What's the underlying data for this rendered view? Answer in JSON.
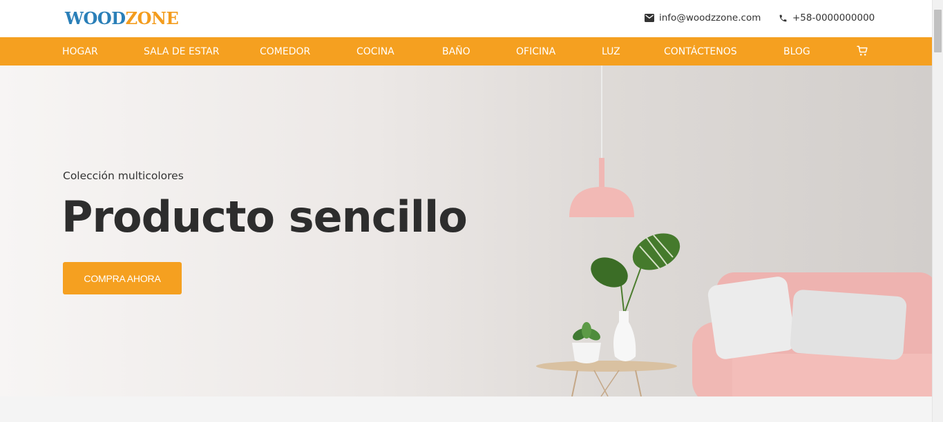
{
  "logo": {
    "part1": "WOOD",
    "part2": "ZONE"
  },
  "contact": {
    "email": "info@woodzzone.com",
    "phone": "+58-0000000000",
    "email_icon": "envelope-icon",
    "phone_icon": "phone-icon"
  },
  "nav": {
    "items": [
      "HOGAR",
      "SALA DE ESTAR",
      "COMEDOR",
      "COCINA",
      "BAÑO",
      "OFICINA",
      "LUZ",
      "CONTÁCTENOS",
      "BLOG"
    ],
    "cart_icon": "cart-icon"
  },
  "hero": {
    "subtitle": "Colección multicolores",
    "title": "Producto sencillo",
    "button": "COMPRA AHORA"
  },
  "colors": {
    "accent": "#f5a020",
    "logo_blue": "#2a7fb8",
    "logo_orange": "#f39c1e",
    "title_text": "#2d2d2d"
  }
}
